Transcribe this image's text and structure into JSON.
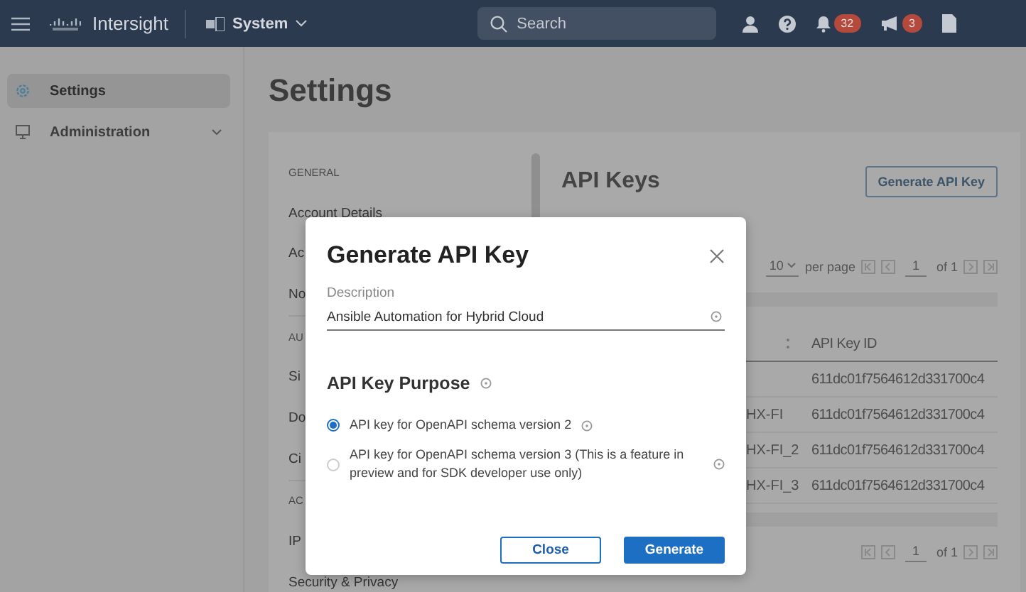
{
  "topbar": {
    "brand": "Intersight",
    "context": "System",
    "search": {
      "placeholder": "Search"
    },
    "notifications": "32",
    "announcements": "3"
  },
  "sidebar": {
    "items": [
      {
        "label": "Settings",
        "selected": true,
        "expandable": false
      },
      {
        "label": "Administration",
        "selected": false,
        "expandable": true
      }
    ]
  },
  "page": {
    "title": "Settings"
  },
  "settings_nav": {
    "items": [
      {
        "kind": "header",
        "label": "GENERAL"
      },
      {
        "kind": "link",
        "label": "Account Details"
      },
      {
        "kind": "link",
        "label": "Ac"
      },
      {
        "kind": "link",
        "label": "No"
      },
      {
        "kind": "header",
        "label": "AU"
      },
      {
        "kind": "link",
        "label": "Si"
      },
      {
        "kind": "link",
        "label": "Do"
      },
      {
        "kind": "link",
        "label": "Ci"
      },
      {
        "kind": "header",
        "label": "AC"
      },
      {
        "kind": "link",
        "label": "IP"
      },
      {
        "kind": "link",
        "label": "Security & Privacy"
      }
    ]
  },
  "api_keys": {
    "title": "API Keys",
    "generate_button": "Generate API Key",
    "page_size": "10",
    "per_page_label": "per page",
    "page": "1",
    "page_count_label": "of 1",
    "columns": [
      "API Key ID"
    ],
    "rows": [
      {
        "id": "611dc01f7564612d331700c4"
      },
      {
        "name": "HX-FI",
        "id": "611dc01f7564612d331700c4"
      },
      {
        "name": "HX-FI_2",
        "id": "611dc01f7564612d331700c4"
      },
      {
        "name": "HX-FI_3",
        "id": "611dc01f7564612d331700c4"
      }
    ],
    "bottom_page": "1",
    "bottom_page_count_label": "of 1"
  },
  "dialog": {
    "title": "Generate API Key",
    "description": {
      "label": "Description",
      "value": "Ansible Automation for Hybrid Cloud"
    },
    "purpose_title": "API Key Purpose",
    "options": [
      {
        "label": "API key for OpenAPI schema version 2",
        "selected": true
      },
      {
        "label": "API key for OpenAPI schema version 3 (This is a feature in preview and for SDK developer use only)",
        "selected": false
      }
    ],
    "buttons": [
      {
        "kind": "secondary",
        "label": "Close"
      },
      {
        "kind": "primary",
        "label": "Generate"
      }
    ]
  }
}
